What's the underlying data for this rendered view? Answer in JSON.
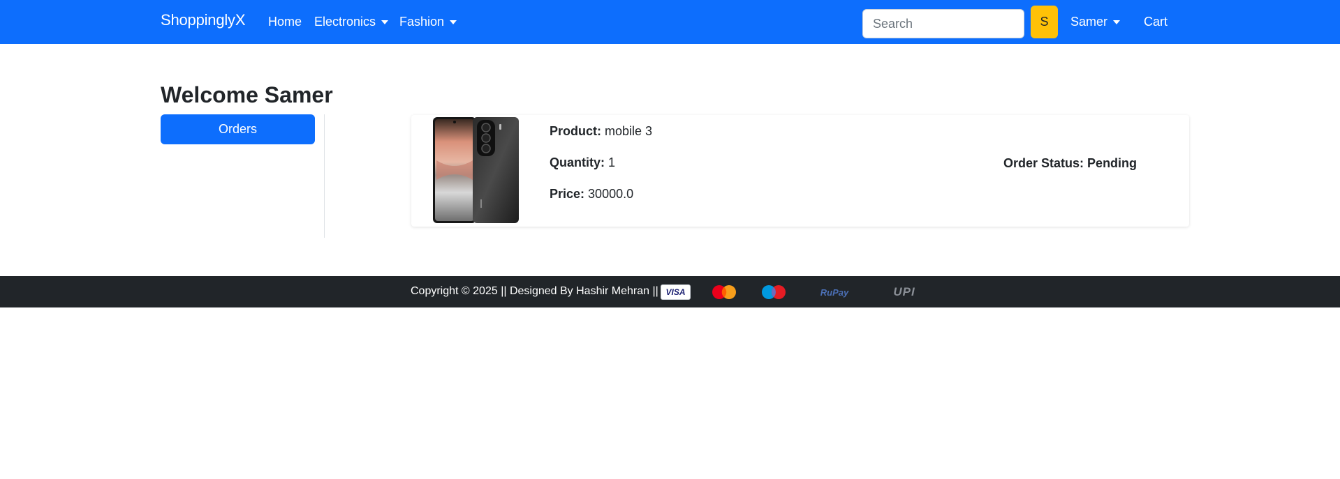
{
  "navbar": {
    "brand": "ShoppinglyX",
    "links": {
      "home": "Home",
      "electronics": "Electronics",
      "fashion": "Fashion"
    },
    "search": {
      "placeholder": "Search",
      "value": ""
    },
    "search_button": "S",
    "user": "Samer",
    "cart": "Cart"
  },
  "main": {
    "welcome": "Welcome Samer",
    "sidebar": {
      "orders_label": "Orders"
    },
    "order": {
      "product_label": "Product:",
      "product": "mobile 3",
      "quantity_label": "Quantity:",
      "quantity": "1",
      "price_label": "Price:",
      "price": "30000.0",
      "status_label": "Order Status:",
      "status": "Pending"
    }
  },
  "footer": {
    "copyright": "Copyright © 2025 || Designed By Hashir Mehran ||",
    "payments": [
      "VISA",
      "MasterCard",
      "Maestro",
      "RuPay",
      "UPI"
    ]
  },
  "colors": {
    "primary": "#0d6efd",
    "warning": "#ffc107",
    "dark": "#212529"
  },
  "icons": {
    "product_image": "phone-image",
    "dropdown": "caret-down-icon"
  }
}
